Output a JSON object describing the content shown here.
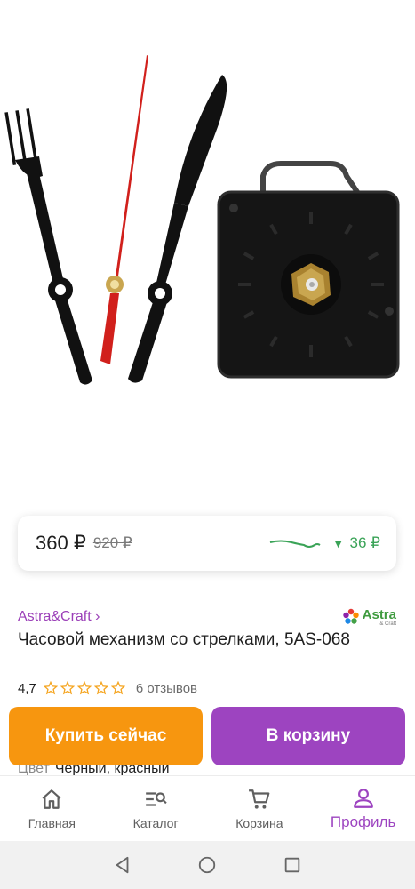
{
  "price": {
    "current": "360 ₽",
    "old": "920 ₽",
    "drop": "36 ₽",
    "trend_color": "#3aa357"
  },
  "seller": {
    "name": "Astra&Craft ›",
    "logo_main": "Astra",
    "logo_sub": "& Craft"
  },
  "product": {
    "title": "Часовой механизм со стрелками, 5AS-068",
    "rating": "4,7",
    "stars": 5,
    "reviews": "6 отзывов",
    "color_label": "Цвет",
    "color_value": "Черный, красный"
  },
  "actions": {
    "buy_now": "Купить сейчас",
    "add_to_cart": "В корзину",
    "buy_color": "#f7960f",
    "cart_color": "#9d44c0"
  },
  "nav": {
    "items": [
      {
        "label": "Главная",
        "icon": "home-icon"
      },
      {
        "label": "Каталог",
        "icon": "catalog-search-icon"
      },
      {
        "label": "Корзина",
        "icon": "cart-icon"
      },
      {
        "label": "Профиль",
        "icon": "profile-icon",
        "active": true
      }
    ],
    "active_color": "#9d44c0"
  },
  "system_nav": [
    "back-icon",
    "home-circle-icon",
    "recents-icon"
  ]
}
